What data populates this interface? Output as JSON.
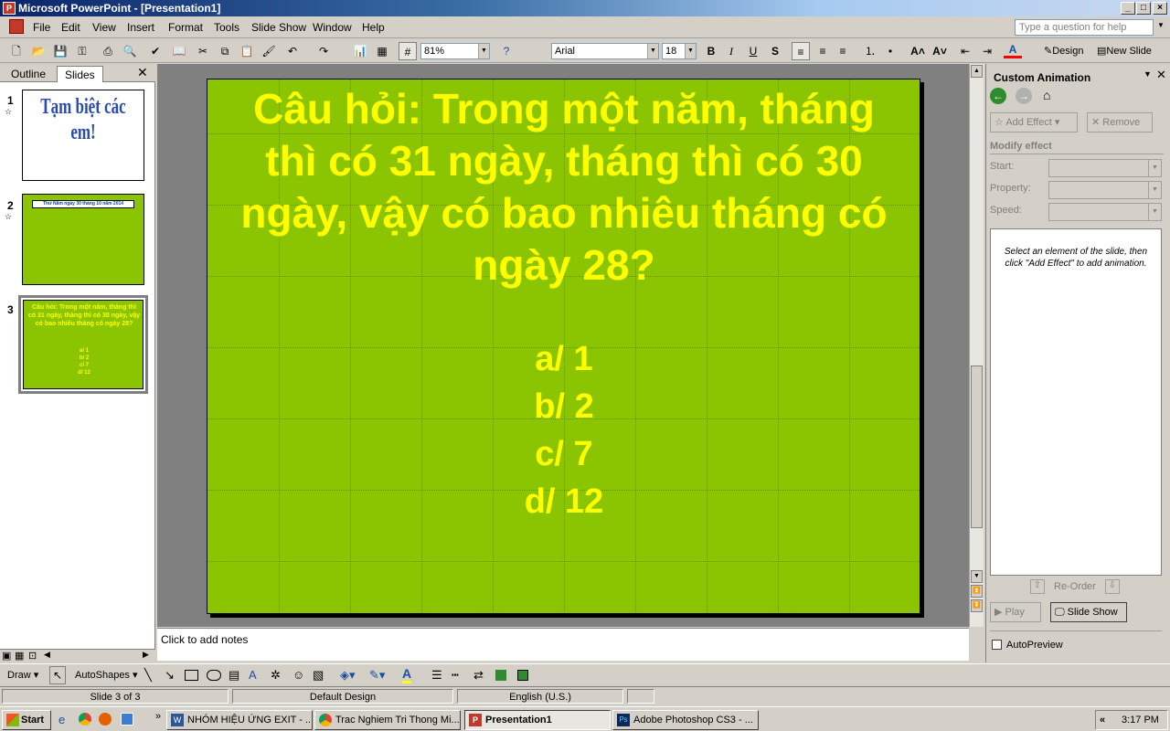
{
  "window": {
    "title": "Microsoft PowerPoint - [Presentation1]"
  },
  "menus": [
    "File",
    "Edit",
    "View",
    "Insert",
    "Format",
    "Tools",
    "Slide Show",
    "Window",
    "Help"
  ],
  "help_box": {
    "placeholder": "Type a question for help"
  },
  "toolbar": {
    "zoom": "81%",
    "font": "Arial",
    "font_size": "18",
    "design_label": "Design",
    "new_slide_label": "New Slide"
  },
  "left_pane": {
    "tabs": [
      "Outline",
      "Slides"
    ],
    "slides": [
      {
        "num": "1",
        "text": "Tạm biệt các em!"
      },
      {
        "num": "2",
        "text": "Thứ Năm ngày 30 tháng 10 năm 2014"
      },
      {
        "num": "3",
        "text": "Câu hỏi: Trong một năm, tháng thì có 31 ngày, tháng thì có 30 ngày, vậy có bao nhiêu tháng có ngày 28?",
        "answers": [
          "a/ 1",
          "b/ 2",
          "c/ 7",
          "d/ 12"
        ]
      }
    ]
  },
  "slide": {
    "question": "Câu hỏi: Trong một năm, tháng thì có 31 ngày, tháng thì có 30 ngày, vậy có bao nhiêu tháng có ngày 28?",
    "answers": [
      "a/ 1",
      "b/ 2",
      "c/ 7",
      "d/ 12"
    ],
    "bg_color": "#8bc400",
    "text_color": "#ffff00"
  },
  "notes": {
    "placeholder": "Click to add notes"
  },
  "task_pane": {
    "title": "Custom Animation",
    "add_effect": "Add Effect",
    "remove": "Remove",
    "modify_effect": "Modify effect",
    "start_label": "Start:",
    "property_label": "Property:",
    "speed_label": "Speed:",
    "hint": "Select an element of the slide, then click \"Add Effect\" to add animation.",
    "reorder": "Re-Order",
    "play": "Play",
    "slide_show": "Slide Show",
    "autopreview": "AutoPreview"
  },
  "draw_toolbar": {
    "draw": "Draw",
    "autoshapes": "AutoShapes"
  },
  "status": {
    "slide": "Slide 3 of 3",
    "design": "Default Design",
    "language": "English (U.S.)"
  },
  "taskbar": {
    "start": "Start",
    "items": [
      "NHÓM HIỆU ỨNG EXIT - ...",
      "Trac Nghiem Tri Thong Mi...",
      "Presentation1",
      "Adobe Photoshop CS3 - ..."
    ],
    "clock": "3:17 PM"
  }
}
